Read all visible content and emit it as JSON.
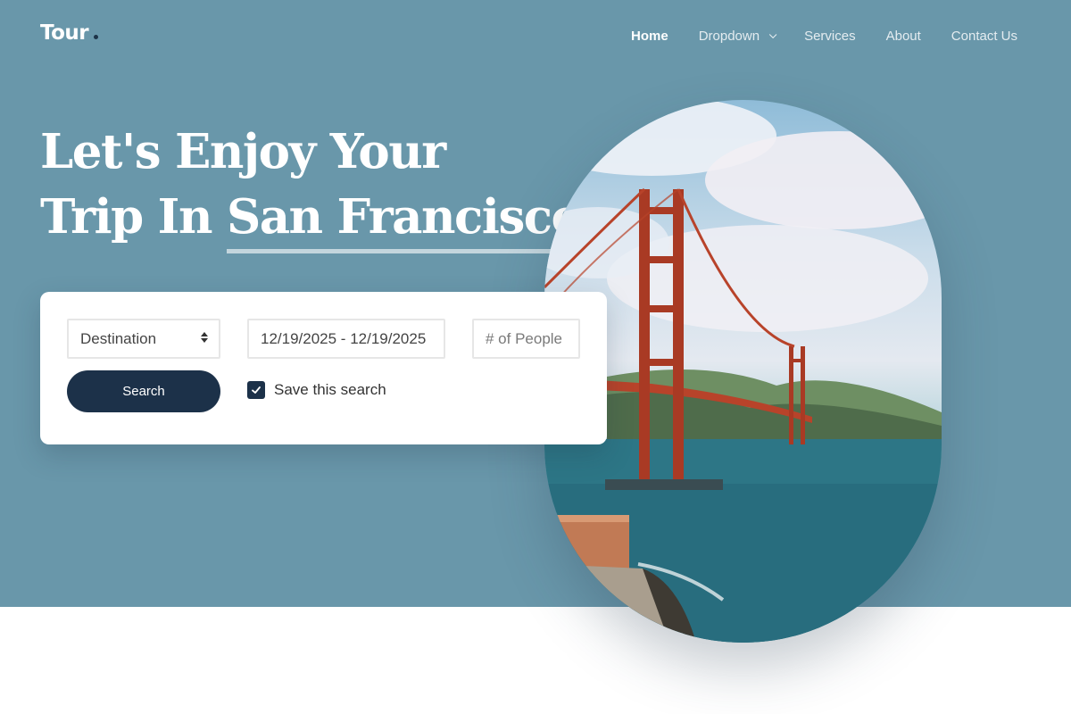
{
  "brand": {
    "name": "Tour"
  },
  "nav": {
    "items": [
      {
        "label": "Home",
        "active": true
      },
      {
        "label": "Dropdown",
        "has_dropdown": true
      },
      {
        "label": "Services"
      },
      {
        "label": "About"
      },
      {
        "label": "Contact Us"
      }
    ]
  },
  "hero": {
    "line1": "Let's Enjoy Your",
    "line2_prefix": "Trip In ",
    "highlight": "San Francisco"
  },
  "search": {
    "destination": "Destination",
    "dates": "12/19/2025 - 12/19/2025",
    "people_placeholder": "# of People",
    "button": "Search",
    "save_label": "Save this search",
    "save_checked": true
  },
  "colors": {
    "hero_bg": "#6997aa",
    "accent_dark": "#1c3149",
    "white": "#ffffff"
  },
  "image": {
    "subject": "golden-gate-bridge-photo"
  }
}
